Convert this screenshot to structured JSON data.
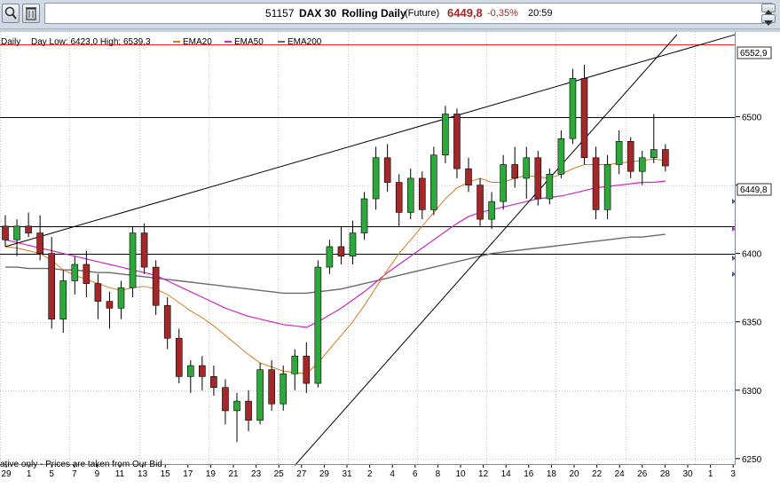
{
  "toolbar": {
    "code": "51157",
    "symbol": "DAX 30",
    "name": "Rolling Daily",
    "kind": "(Future)",
    "price": "6449,8",
    "change": "-0,35%",
    "time": "20:59"
  },
  "colors": {
    "up": "#2ea83a",
    "down": "#a4282a",
    "ema20": "#d97c1f",
    "ema50": "#d025c7",
    "ema200": "#6a6a6a",
    "priceTag": "#ff2020"
  },
  "chart_data": {
    "type": "candlestick",
    "info_prefix": "Daily",
    "info_stats": "Day Low: 6423,0 High: 6539,3",
    "legend": [
      "EMA20",
      "EMA50",
      "EMA200"
    ],
    "disclaimer": "ative only - Prices are taken from Our Bid",
    "ylim": [
      6246,
      6562
    ],
    "yticks": [
      6250,
      6300,
      6350,
      6400,
      6450,
      6500
    ],
    "ytick_labels": [
      "6250",
      "6300",
      "6350",
      "6400",
      "",
      "6500"
    ],
    "price_label": "6449,8",
    "resistance_label": "6552,9",
    "hlines": [
      6552.9,
      6500,
      6420,
      6400
    ],
    "xtick_labels": [
      "29",
      "31",
      "2",
      "5",
      "7",
      "9",
      "11",
      "13",
      "15",
      "17",
      "19",
      "21",
      "23",
      "25",
      "27",
      "29",
      "31",
      "2",
      "4",
      "6",
      "8",
      "10",
      "12",
      "14",
      "16",
      "18",
      "20",
      "22",
      "24",
      "26",
      "28",
      "30",
      "1",
      "3",
      "5",
      "7",
      "9",
      "11",
      "13",
      "15",
      "17",
      "19",
      "21",
      "23",
      "25",
      "27",
      "29",
      "31",
      "2",
      "4",
      "6",
      "8",
      "10",
      "12",
      "14",
      "16",
      "18",
      "20",
      "22",
      "24",
      "26",
      "28",
      "30",
      "1",
      "3"
    ],
    "xticks_shown": [
      "29",
      "1",
      "5",
      "7",
      "9",
      "11",
      "13",
      "15",
      "17",
      "19",
      "21",
      "23",
      "25",
      "27",
      "29",
      "31",
      "2",
      "4",
      "6",
      "8",
      "10",
      "12",
      "14",
      "16",
      "18",
      "20",
      "22",
      "24",
      "26",
      "28",
      "30",
      "1",
      "3"
    ],
    "candles": [
      [
        6420,
        6428,
        6405,
        6410
      ],
      [
        6410,
        6425,
        6398,
        6420
      ],
      [
        6420,
        6430,
        6412,
        6415
      ],
      [
        6415,
        6428,
        6395,
        6400
      ],
      [
        6400,
        6412,
        6345,
        6352
      ],
      [
        6352,
        6388,
        6342,
        6380
      ],
      [
        6380,
        6398,
        6370,
        6392
      ],
      [
        6392,
        6402,
        6368,
        6378
      ],
      [
        6378,
        6385,
        6352,
        6365
      ],
      [
        6365,
        6372,
        6345,
        6360
      ],
      [
        6360,
        6380,
        6352,
        6375
      ],
      [
        6375,
        6420,
        6368,
        6415
      ],
      [
        6415,
        6422,
        6385,
        6390
      ],
      [
        6390,
        6395,
        6355,
        6362
      ],
      [
        6362,
        6368,
        6330,
        6338
      ],
      [
        6338,
        6345,
        6305,
        6310
      ],
      [
        6310,
        6322,
        6298,
        6318
      ],
      [
        6318,
        6325,
        6300,
        6310
      ],
      [
        6310,
        6318,
        6296,
        6302
      ],
      [
        6302,
        6308,
        6275,
        6285
      ],
      [
        6285,
        6298,
        6262,
        6292
      ],
      [
        6292,
        6300,
        6270,
        6278
      ],
      [
        6278,
        6320,
        6275,
        6315
      ],
      [
        6315,
        6322,
        6285,
        6290
      ],
      [
        6290,
        6318,
        6285,
        6312
      ],
      [
        6312,
        6330,
        6300,
        6325
      ],
      [
        6325,
        6335,
        6298,
        6305
      ],
      [
        6305,
        6395,
        6302,
        6390
      ],
      [
        6390,
        6410,
        6385,
        6405
      ],
      [
        6405,
        6420,
        6392,
        6398
      ],
      [
        6398,
        6424,
        6392,
        6415
      ],
      [
        6415,
        6445,
        6410,
        6440
      ],
      [
        6440,
        6478,
        6432,
        6470
      ],
      [
        6470,
        6480,
        6445,
        6452
      ],
      [
        6452,
        6458,
        6420,
        6430
      ],
      [
        6430,
        6462,
        6425,
        6455
      ],
      [
        6455,
        6460,
        6425,
        6432
      ],
      [
        6432,
        6478,
        6428,
        6472
      ],
      [
        6472,
        6508,
        6466,
        6502
      ],
      [
        6502,
        6506,
        6455,
        6462
      ],
      [
        6462,
        6470,
        6445,
        6450
      ],
      [
        6450,
        6455,
        6420,
        6425
      ],
      [
        6425,
        6445,
        6418,
        6438
      ],
      [
        6438,
        6472,
        6432,
        6465
      ],
      [
        6465,
        6478,
        6448,
        6455
      ],
      [
        6455,
        6478,
        6440,
        6470
      ],
      [
        6470,
        6475,
        6435,
        6440
      ],
      [
        6440,
        6462,
        6436,
        6458
      ],
      [
        6458,
        6490,
        6455,
        6484
      ],
      [
        6484,
        6535,
        6480,
        6528
      ],
      [
        6528,
        6538,
        6465,
        6470
      ],
      [
        6470,
        6478,
        6425,
        6432
      ],
      [
        6432,
        6472,
        6425,
        6465
      ],
      [
        6465,
        6490,
        6458,
        6482
      ],
      [
        6482,
        6485,
        6455,
        6460
      ],
      [
        6460,
        6475,
        6450,
        6470
      ],
      [
        6470,
        6502,
        6466,
        6476
      ],
      [
        6476,
        6480,
        6460,
        6464
      ]
    ],
    "ema20": [
      6405,
      6404,
      6402,
      6400,
      6395,
      6388,
      6384,
      6381,
      6378,
      6375,
      6373,
      6375,
      6376,
      6374,
      6370,
      6364,
      6358,
      6353,
      6347,
      6340,
      6333,
      6326,
      6320,
      6317,
      6314,
      6313,
      6312,
      6320,
      6330,
      6340,
      6350,
      6362,
      6375,
      6388,
      6400,
      6410,
      6420,
      6430,
      6440,
      6448,
      6452,
      6455,
      6452,
      6452,
      6455,
      6457,
      6456,
      6455,
      6458,
      6462,
      6465,
      6465,
      6465,
      6466,
      6467,
      6468,
      6469,
      6468
    ],
    "ema50": [
      6410,
      6408,
      6406,
      6404,
      6402,
      6400,
      6398,
      6396,
      6394,
      6392,
      6390,
      6388,
      6386,
      6384,
      6380,
      6376,
      6372,
      6368,
      6364,
      6360,
      6357,
      6354,
      6352,
      6350,
      6348,
      6347,
      6346,
      6350,
      6355,
      6360,
      6366,
      6372,
      6379,
      6386,
      6392,
      6398,
      6404,
      6410,
      6416,
      6422,
      6427,
      6430,
      6432,
      6434,
      6436,
      6438,
      6440,
      6441,
      6442,
      6444,
      6446,
      6448,
      6449,
      6450,
      6451,
      6452,
      6452,
      6453
    ],
    "ema200": [
      6390,
      6390,
      6389,
      6389,
      6389,
      6388,
      6388,
      6387,
      6386,
      6386,
      6385,
      6384,
      6383,
      6382,
      6381,
      6380,
      6379,
      6378,
      6377,
      6376,
      6375,
      6374,
      6373,
      6372,
      6371,
      6371,
      6371,
      6372,
      6373,
      6374,
      6376,
      6378,
      6380,
      6382,
      6384,
      6386,
      6388,
      6390,
      6392,
      6394,
      6396,
      6398,
      6400,
      6401,
      6402,
      6403,
      6404,
      6405,
      6406,
      6407,
      6408,
      6409,
      6410,
      6411,
      6412,
      6412,
      6413,
      6414
    ],
    "trendlines": [
      {
        "from": [
          0,
          6405
        ],
        "to": [
          63,
          6560
        ]
      },
      {
        "from": [
          25,
          6245
        ],
        "to": [
          58,
          6560
        ]
      }
    ]
  }
}
